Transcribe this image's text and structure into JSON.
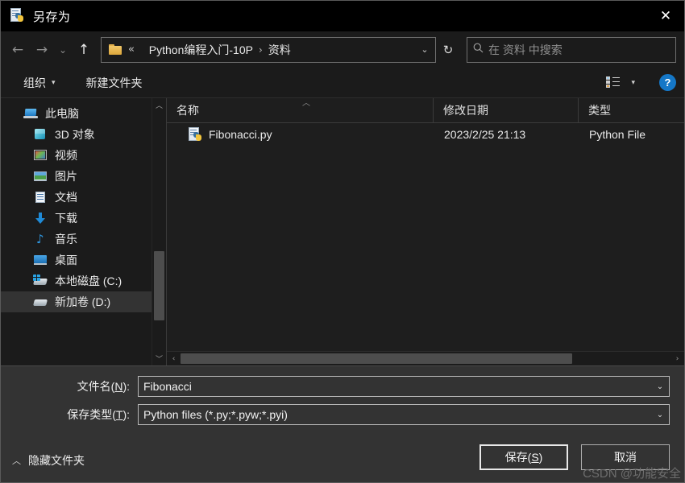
{
  "window": {
    "title": "另存为",
    "title_icon": "python-file-icon",
    "close_label": "✕"
  },
  "nav": {
    "back_icon": "←",
    "forward_icon": "→",
    "recent_icon": "⌄",
    "up_icon": "↑",
    "refresh_icon": "↻",
    "address_caret": "⌄",
    "folder_icon": "folder-icon",
    "breadcrumb_ellipsis": "«",
    "breadcrumb": [
      {
        "label": "Python编程入门-10P"
      },
      {
        "label": "资料"
      }
    ],
    "breadcrumb_separator": "›"
  },
  "search": {
    "icon": "search-icon",
    "placeholder": "在 资料 中搜索",
    "value": ""
  },
  "toolbar": {
    "organize_label": "组织",
    "organize_caret": "▾",
    "new_folder_label": "新建文件夹",
    "view_caret": "▾",
    "help_label": "?"
  },
  "sidebar": {
    "scroll_up_icon": "︿",
    "scroll_down_icon": "﹀",
    "items": [
      {
        "label": "此电脑",
        "icon": "this-pc-icon",
        "selected": false,
        "indent": false
      },
      {
        "label": "3D 对象",
        "icon": "3d-objects-icon",
        "selected": false,
        "indent": true
      },
      {
        "label": "视频",
        "icon": "videos-icon",
        "selected": false,
        "indent": true
      },
      {
        "label": "图片",
        "icon": "pictures-icon",
        "selected": false,
        "indent": true
      },
      {
        "label": "文档",
        "icon": "documents-icon",
        "selected": false,
        "indent": true
      },
      {
        "label": "下载",
        "icon": "downloads-icon",
        "selected": false,
        "indent": true
      },
      {
        "label": "音乐",
        "icon": "music-icon",
        "selected": false,
        "indent": true
      },
      {
        "label": "桌面",
        "icon": "desktop-icon",
        "selected": false,
        "indent": true
      },
      {
        "label": "本地磁盘 (C:)",
        "icon": "local-disk-icon",
        "selected": false,
        "indent": true
      },
      {
        "label": "新加卷 (D:)",
        "icon": "drive-icon",
        "selected": true,
        "indent": true
      }
    ]
  },
  "filelist": {
    "columns": [
      {
        "label": "名称",
        "sorted": "asc",
        "sort_caret": "︿"
      },
      {
        "label": "修改日期",
        "sorted": ""
      },
      {
        "label": "类型",
        "sorted": ""
      }
    ],
    "rows": [
      {
        "name": "Fibonacci.py",
        "modified": "2023/2/25 21:13",
        "type": "Python File",
        "icon": "python-file-icon"
      }
    ],
    "hscroll_left_icon": "‹",
    "hscroll_right_icon": "›"
  },
  "form": {
    "filename": {
      "label_prefix": "文件名(",
      "label_key": "N",
      "label_suffix": "):",
      "value": "Fibonacci",
      "caret": "⌄"
    },
    "filetype": {
      "label_prefix": "保存类型(",
      "label_key": "T",
      "label_suffix": "):",
      "value": "Python files (*.py;*.pyw;*.pyi)",
      "caret": "⌄"
    }
  },
  "footer": {
    "hide_folders_caret": "︿",
    "hide_folders_label": "隐藏文件夹",
    "save": {
      "prefix": "保存(",
      "key": "S",
      "suffix": ")"
    },
    "cancel_label": "取消"
  },
  "watermark": "CSDN @功能安全",
  "colors": {
    "window_bg": "#1e1e1e",
    "titlebar_bg": "#000000",
    "panel_bg": "#333333",
    "selection_bg": "#333333",
    "accent_blue": "#1577c7",
    "text": "#eaeaea",
    "muted_text": "#8f8f8f",
    "border": "#b7b7b7"
  }
}
